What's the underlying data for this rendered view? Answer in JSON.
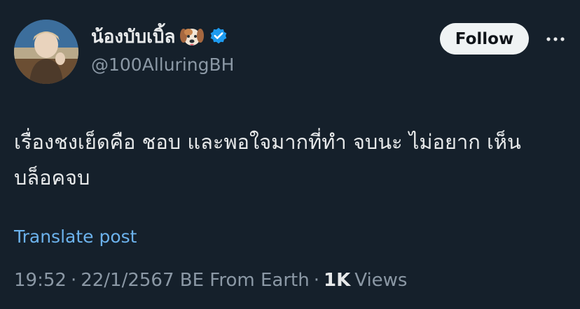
{
  "author": {
    "display_name": "น้องบับเบิ้ล",
    "handle": "@100AlluringBH",
    "emoji_icon": "dog-face-icon",
    "verified_icon": "verified-badge-icon",
    "verified_color": "#1d9bf0"
  },
  "actions": {
    "follow_label": "Follow",
    "more_icon": "more-icon"
  },
  "post": {
    "text": "เรื่องชงเย็ดคือ ชอบ และพอใจมากที่ทำ จบนะ ไม่อยาก เห็น บล็อคจบ",
    "translate_label": "Translate post"
  },
  "meta": {
    "time": "19:52",
    "separator_1": "·",
    "date": "22/1/2567 BE From Earth",
    "separator_2": "·",
    "views_count": "1K",
    "views_label": "Views"
  },
  "colors": {
    "background": "#15202b",
    "text_primary": "#e7e9ea",
    "text_secondary": "#8b98a5",
    "link": "#6cb2ec"
  }
}
